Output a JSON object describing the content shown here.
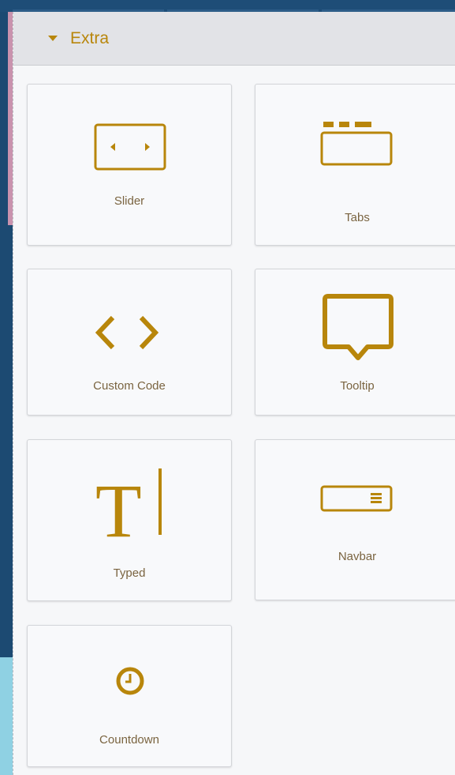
{
  "panel": {
    "title": "Extra",
    "blocks": [
      {
        "label": "Slider",
        "icon": "slider-icon"
      },
      {
        "label": "Tabs",
        "icon": "tabs-icon"
      },
      {
        "label": "Custom Code",
        "icon": "code-icon"
      },
      {
        "label": "Tooltip",
        "icon": "tooltip-icon"
      },
      {
        "label": "Typed",
        "icon": "typed-text-icon"
      },
      {
        "label": "Navbar",
        "icon": "navbar-icon"
      },
      {
        "label": "Countdown",
        "icon": "clock-icon"
      }
    ]
  },
  "colors": {
    "accent": "#b8860b",
    "background": "#1c4a72"
  }
}
